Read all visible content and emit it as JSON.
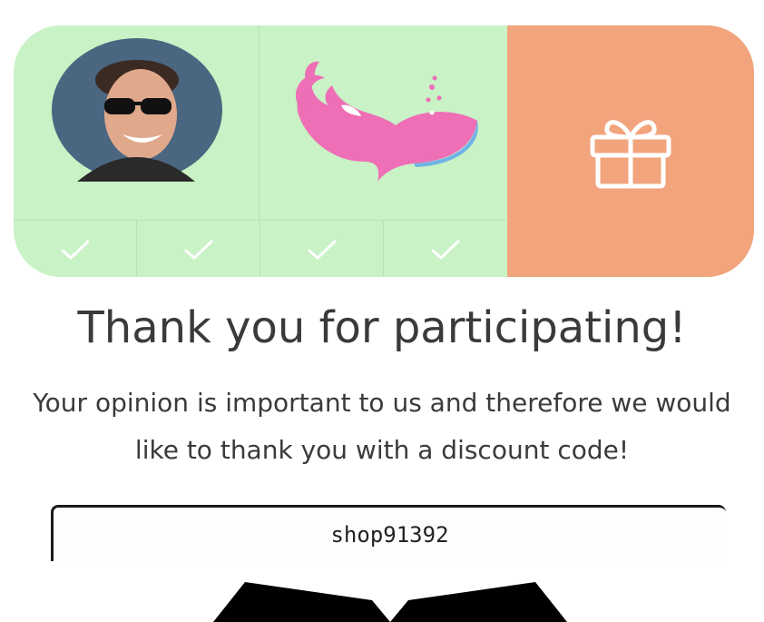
{
  "progress": {
    "completed_steps": 4,
    "total_steps": 4,
    "colors": {
      "done_bg": "#c9f2c6",
      "reward_bg": "#f2a47d",
      "whale": "#ee6fb6"
    }
  },
  "icons": {
    "avatar": "avatar-photo",
    "brand": "whale-icon",
    "reward": "gift-icon",
    "step": "checkmark-icon"
  },
  "thankyou": {
    "title": "Thank you for participating!",
    "message": "Your opinion is important to us and therefore we would like to thank you with a discount code!"
  },
  "discount": {
    "code": "shop91392"
  }
}
